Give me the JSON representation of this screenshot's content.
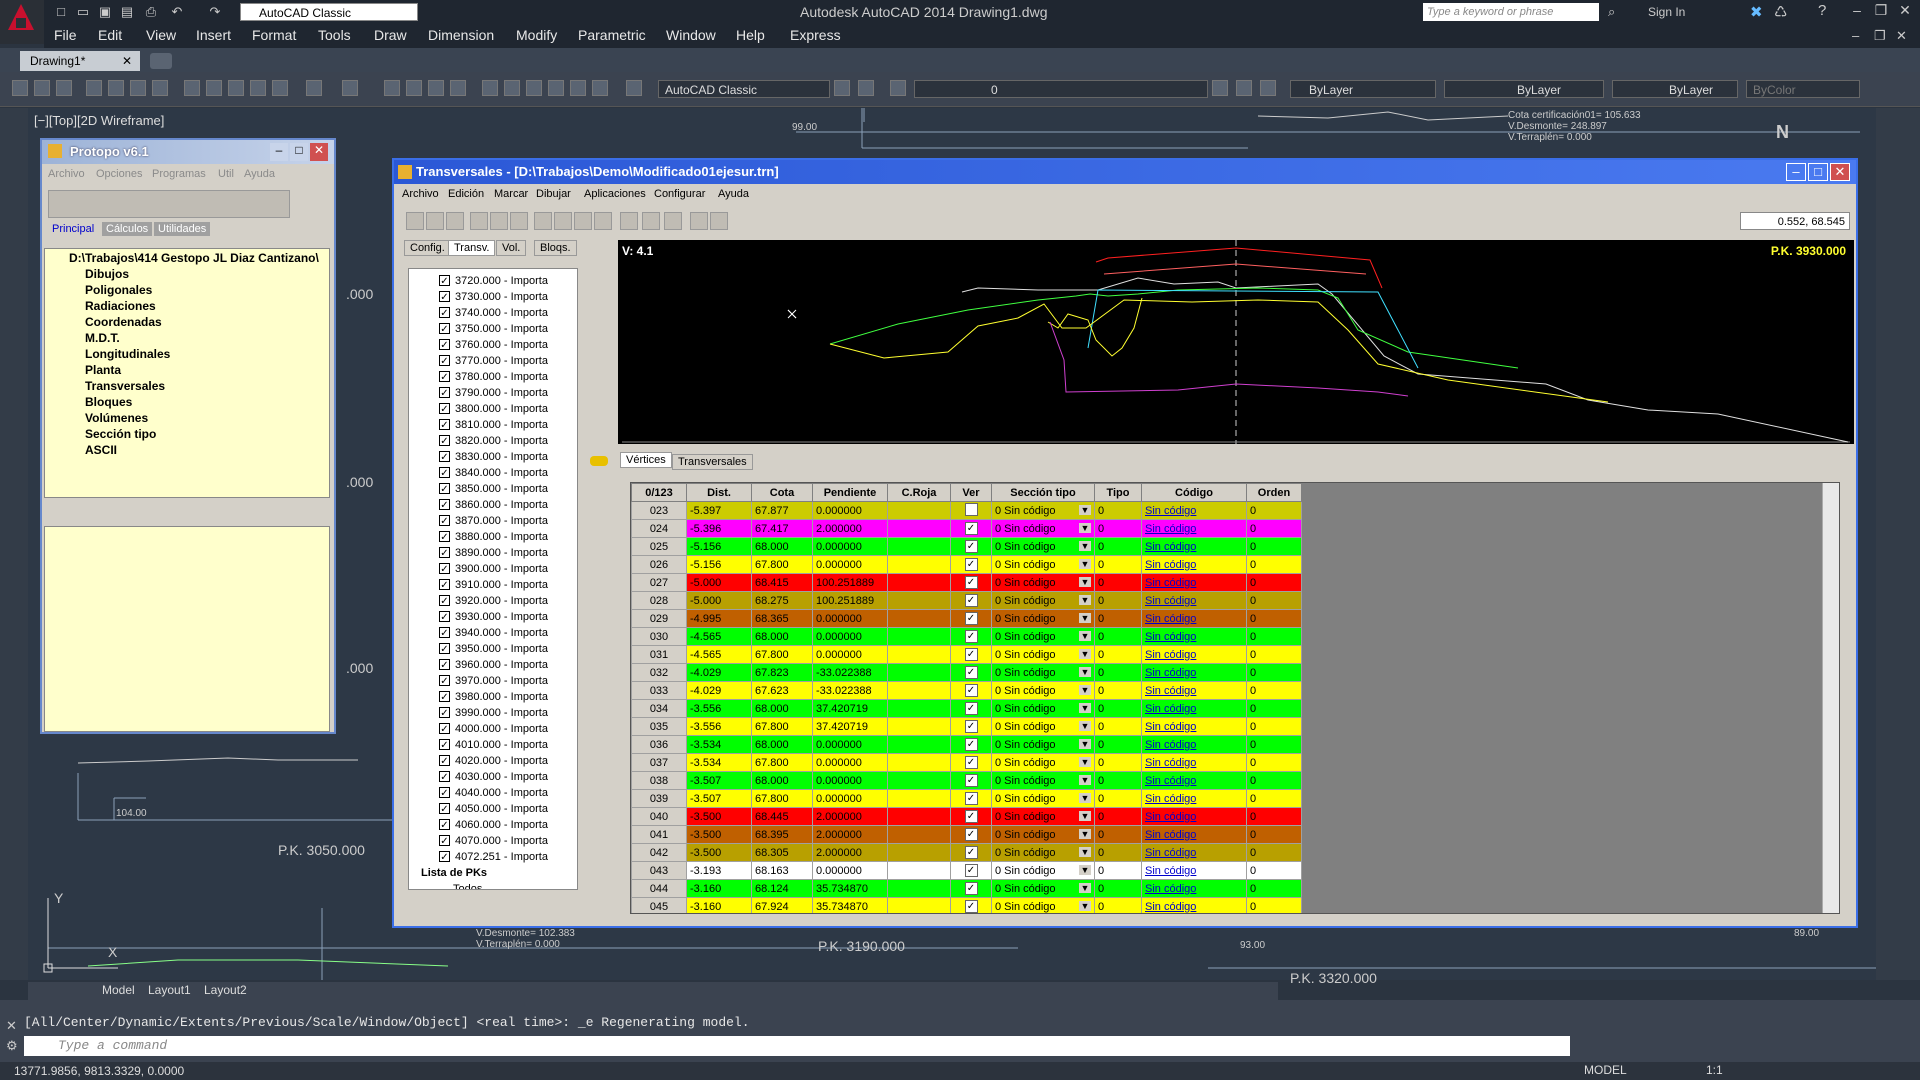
{
  "app": {
    "title": "Autodesk AutoCAD 2014    Drawing1.dwg",
    "workspace": "AutoCAD Classic",
    "search_placeholder": "Type a keyword or phrase",
    "sign_in": "Sign In",
    "doc_tab": "Drawing1*"
  },
  "menu": [
    "File",
    "Edit",
    "View",
    "Insert",
    "Format",
    "Tools",
    "Draw",
    "Dimension",
    "Modify",
    "Parametric",
    "Window",
    "Help",
    "Express"
  ],
  "toolbar": {
    "workspace": "AutoCAD Classic",
    "layer": "0",
    "color": "ByLayer",
    "linetype": "ByLayer",
    "lineweight": "ByLayer",
    "plotstyle": "ByColor"
  },
  "canvas": {
    "view_label": "[−][Top][2D Wireframe]",
    "texts": {
      "t1": "99.00",
      "t2": "Cota certificación01= 105.633",
      "t3": "V.Desmonte= 248.897",
      "t4": "V.Terraplén= 0.000",
      "t5": ".000",
      "t6": ".000",
      "t7": ".000",
      "t8": "104.00",
      "t9": "P.K. 3050.000",
      "t10": "V.Desmonte= 102.383",
      "t11": "V.Terraplén= 0.000",
      "t12": "P.K. 3190.000",
      "t13": "93.00",
      "t14": "P.K. 3320.000",
      "t15": "89.00",
      "compass": "N",
      "y_axis": "Y",
      "x_axis": "X"
    },
    "layout_tabs": [
      "Model",
      "Layout1",
      "Layout2"
    ]
  },
  "command": {
    "history": "[All/Center/Dynamic/Extents/Previous/Scale/Window/Object] <real time>: _e Regenerating model.",
    "placeholder": "Type a command"
  },
  "status": {
    "coords": "13771.9856, 9813.3329, 0.0000",
    "model": "MODEL",
    "scale": "1:1"
  },
  "protopo": {
    "title": "Protopo v6.1",
    "menu": [
      "Archivo",
      "Opciones",
      "Programas",
      "Util",
      "Ayuda"
    ],
    "tabs": [
      "Principal",
      "Cálculos",
      "Utilidades"
    ],
    "root": "D:\\Trabajos\\414 Gestopo JL Diaz Cantizano\\",
    "nodes": [
      "Dibujos",
      "Poligonales",
      "Radiaciones",
      "Coordenadas",
      "M.D.T.",
      "Longitudinales",
      "Planta",
      "Transversales",
      "Bloques",
      "Volúmenes",
      "Sección tipo",
      "ASCII"
    ]
  },
  "trans": {
    "title": "Transversales - [D:\\Trabajos\\Demo\\Modificado01ejesur.trn]",
    "menu": [
      "Archivo",
      "Edición",
      "Marcar",
      "Dibujar",
      "Aplicaciones",
      "Configurar",
      "Ayuda"
    ],
    "coord_box": "0.552, 68.545",
    "left_tabs": [
      "Config.",
      "Transv.",
      "Vol.",
      "Bloqs."
    ],
    "pk_items": [
      "3720.000 - Importa",
      "3730.000 - Importa",
      "3740.000 - Importa",
      "3750.000 - Importa",
      "3760.000 - Importa",
      "3770.000 - Importa",
      "3780.000 - Importa",
      "3790.000 - Importa",
      "3800.000 - Importa",
      "3810.000 - Importa",
      "3820.000 - Importa",
      "3830.000 - Importa",
      "3840.000 - Importa",
      "3850.000 - Importa",
      "3860.000 - Importa",
      "3870.000 - Importa",
      "3880.000 - Importa",
      "3890.000 - Importa",
      "3900.000 - Importa",
      "3910.000 - Importa",
      "3920.000 - Importa",
      "3930.000 - Importa",
      "3940.000 - Importa",
      "3950.000 - Importa",
      "3960.000 - Importa",
      "3970.000 - Importa",
      "3980.000 - Importa",
      "3990.000 - Importa",
      "4000.000 - Importa",
      "4010.000 - Importa",
      "4020.000 - Importa",
      "4030.000 - Importa",
      "4040.000 - Importa",
      "4050.000 - Importa",
      "4060.000 - Importa",
      "4070.000 - Importa",
      "4072.251 - Importa"
    ],
    "list_pks": "Lista de PKs",
    "todos": "Todos",
    "graph_v": "V: 4.1",
    "graph_pk": "P.K. 3930.000",
    "bottom_tabs": [
      "Vértices",
      "Transversales"
    ],
    "columns": [
      "0/123",
      "Dist.",
      "Cota",
      "Pendiente",
      "C.Roja",
      "Ver",
      "Sección tipo",
      "Tipo",
      "Código",
      "Orden"
    ],
    "rows": [
      {
        "n": "023",
        "dist": "-5.397",
        "cota": "67.877",
        "pend": "0.000000",
        "ver": false,
        "sec": "0  Sin código",
        "tipo": "0",
        "cod": "Sin código",
        "orden": "0",
        "color": "#cccc00"
      },
      {
        "n": "024",
        "dist": "-5.396",
        "cota": "67.417",
        "pend": "2.000000",
        "ver": true,
        "sec": "0  Sin código",
        "tipo": "0",
        "cod": "Sin código",
        "orden": "0",
        "color": "#ff00ff"
      },
      {
        "n": "025",
        "dist": "-5.156",
        "cota": "68.000",
        "pend": "0.000000",
        "ver": true,
        "sec": "0  Sin código",
        "tipo": "0",
        "cod": "Sin código",
        "orden": "0",
        "color": "#00ff00"
      },
      {
        "n": "026",
        "dist": "-5.156",
        "cota": "67.800",
        "pend": "0.000000",
        "ver": true,
        "sec": "0  Sin código",
        "tipo": "0",
        "cod": "Sin código",
        "orden": "0",
        "color": "#ffff00"
      },
      {
        "n": "027",
        "dist": "-5.000",
        "cota": "68.415",
        "pend": "100.251889",
        "ver": true,
        "sec": "0  Sin código",
        "tipo": "0",
        "cod": "Sin código",
        "orden": "0",
        "color": "#ff0000"
      },
      {
        "n": "028",
        "dist": "-5.000",
        "cota": "68.275",
        "pend": "100.251889",
        "ver": true,
        "sec": "0  Sin código",
        "tipo": "0",
        "cod": "Sin código",
        "orden": "0",
        "color": "#b8a000"
      },
      {
        "n": "029",
        "dist": "-4.995",
        "cota": "68.365",
        "pend": "0.000000",
        "ver": true,
        "sec": "0  Sin código",
        "tipo": "0",
        "cod": "Sin código",
        "orden": "0",
        "color": "#c06000"
      },
      {
        "n": "030",
        "dist": "-4.565",
        "cota": "68.000",
        "pend": "0.000000",
        "ver": true,
        "sec": "0  Sin código",
        "tipo": "0",
        "cod": "Sin código",
        "orden": "0",
        "color": "#00ff00"
      },
      {
        "n": "031",
        "dist": "-4.565",
        "cota": "67.800",
        "pend": "0.000000",
        "ver": true,
        "sec": "0  Sin código",
        "tipo": "0",
        "cod": "Sin código",
        "orden": "0",
        "color": "#ffff00"
      },
      {
        "n": "032",
        "dist": "-4.029",
        "cota": "67.823",
        "pend": "-33.022388",
        "ver": true,
        "sec": "0  Sin código",
        "tipo": "0",
        "cod": "Sin código",
        "orden": "0",
        "color": "#00ff00"
      },
      {
        "n": "033",
        "dist": "-4.029",
        "cota": "67.623",
        "pend": "-33.022388",
        "ver": true,
        "sec": "0  Sin código",
        "tipo": "0",
        "cod": "Sin código",
        "orden": "0",
        "color": "#ffff00"
      },
      {
        "n": "034",
        "dist": "-3.556",
        "cota": "68.000",
        "pend": "37.420719",
        "ver": true,
        "sec": "0  Sin código",
        "tipo": "0",
        "cod": "Sin código",
        "orden": "0",
        "color": "#00ff00"
      },
      {
        "n": "035",
        "dist": "-3.556",
        "cota": "67.800",
        "pend": "37.420719",
        "ver": true,
        "sec": "0  Sin código",
        "tipo": "0",
        "cod": "Sin código",
        "orden": "0",
        "color": "#ffff00"
      },
      {
        "n": "036",
        "dist": "-3.534",
        "cota": "68.000",
        "pend": "0.000000",
        "ver": true,
        "sec": "0  Sin código",
        "tipo": "0",
        "cod": "Sin código",
        "orden": "0",
        "color": "#00ff00"
      },
      {
        "n": "037",
        "dist": "-3.534",
        "cota": "67.800",
        "pend": "0.000000",
        "ver": true,
        "sec": "0  Sin código",
        "tipo": "0",
        "cod": "Sin código",
        "orden": "0",
        "color": "#ffff00"
      },
      {
        "n": "038",
        "dist": "-3.507",
        "cota": "68.000",
        "pend": "0.000000",
        "ver": true,
        "sec": "0  Sin código",
        "tipo": "0",
        "cod": "Sin código",
        "orden": "0",
        "color": "#00ff00"
      },
      {
        "n": "039",
        "dist": "-3.507",
        "cota": "67.800",
        "pend": "0.000000",
        "ver": true,
        "sec": "0  Sin código",
        "tipo": "0",
        "cod": "Sin código",
        "orden": "0",
        "color": "#ffff00"
      },
      {
        "n": "040",
        "dist": "-3.500",
        "cota": "68.445",
        "pend": "2.000000",
        "ver": true,
        "sec": "0  Sin código",
        "tipo": "0",
        "cod": "Sin código",
        "orden": "0",
        "color": "#ff0000"
      },
      {
        "n": "041",
        "dist": "-3.500",
        "cota": "68.395",
        "pend": "2.000000",
        "ver": true,
        "sec": "0  Sin código",
        "tipo": "0",
        "cod": "Sin código",
        "orden": "0",
        "color": "#c06000"
      },
      {
        "n": "042",
        "dist": "-3.500",
        "cota": "68.305",
        "pend": "2.000000",
        "ver": true,
        "sec": "0  Sin código",
        "tipo": "0",
        "cod": "Sin código",
        "orden": "0",
        "color": "#b8a000"
      },
      {
        "n": "043",
        "dist": "-3.193",
        "cota": "68.163",
        "pend": "0.000000",
        "ver": true,
        "sec": "0  Sin código",
        "tipo": "0",
        "cod": "Sin código",
        "orden": "0",
        "color": "#ffffff"
      },
      {
        "n": "044",
        "dist": "-3.160",
        "cota": "68.124",
        "pend": "35.734870",
        "ver": true,
        "sec": "0  Sin código",
        "tipo": "0",
        "cod": "Sin código",
        "orden": "0",
        "color": "#00ff00"
      },
      {
        "n": "045",
        "dist": "-3.160",
        "cota": "67.924",
        "pend": "35.734870",
        "ver": true,
        "sec": "0  Sin código",
        "tipo": "0",
        "cod": "Sin código",
        "orden": "0",
        "color": "#ffff00"
      }
    ]
  },
  "colors": {
    "accent": "#3a6ee8",
    "cad_bg": "#2d3846"
  }
}
